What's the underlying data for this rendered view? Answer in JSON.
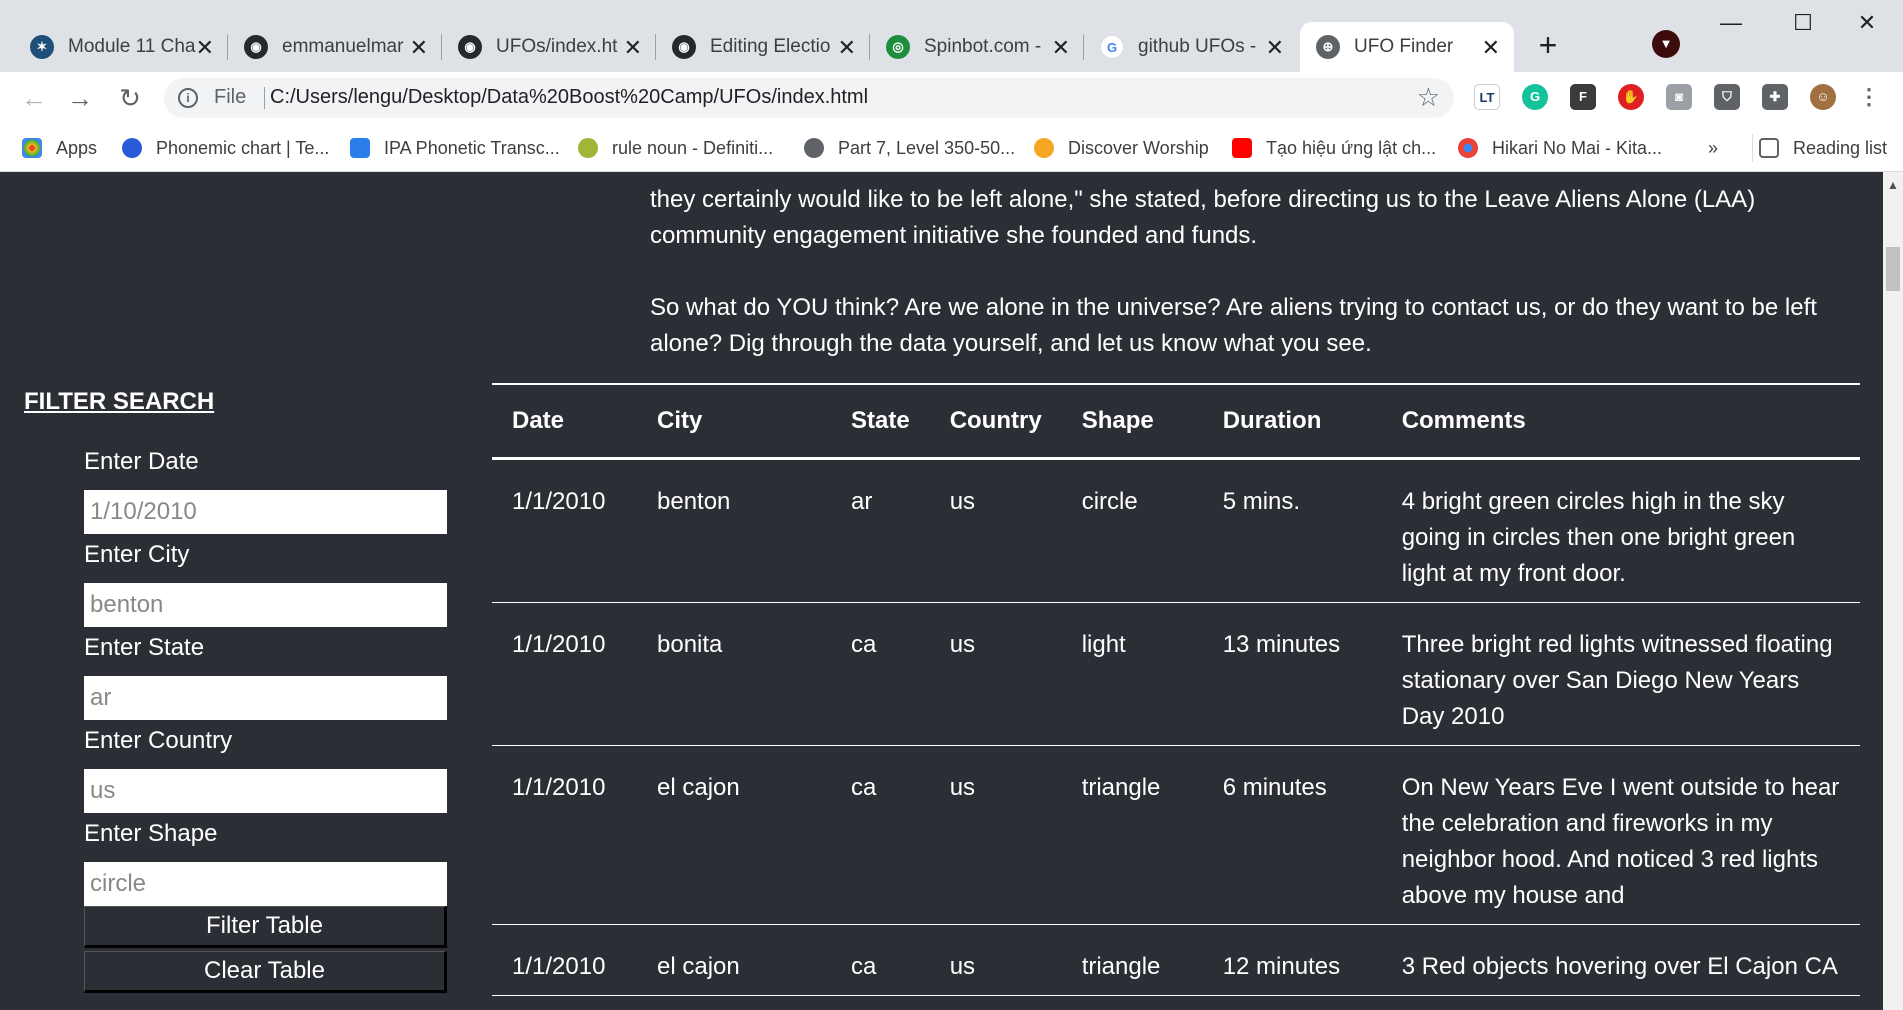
{
  "browser": {
    "tabs": [
      {
        "title": "Module 11 Cha",
        "icon": "hub-icon"
      },
      {
        "title": "emmanuelmar",
        "icon": "github-icon"
      },
      {
        "title": "UFOs/index.ht",
        "icon": "github-icon"
      },
      {
        "title": "Editing Electio",
        "icon": "github-icon"
      },
      {
        "title": "Spinbot.com -",
        "icon": "spinbot-icon"
      },
      {
        "title": "github UFOs -",
        "icon": "google-icon"
      },
      {
        "title": "UFO Finder",
        "icon": "globe-icon"
      }
    ],
    "address": {
      "scheme_label": "File",
      "url": "C:/Users/lengu/Desktop/Data%20Boost%20Camp/UFOs/index.html"
    },
    "bookmarks": [
      {
        "label": "Apps"
      },
      {
        "label": "Phonemic chart | Te..."
      },
      {
        "label": "IPA Phonetic Transc..."
      },
      {
        "label": "rule noun - Definiti..."
      },
      {
        "label": "Part 7, Level 350-50..."
      },
      {
        "label": "Discover Worship"
      },
      {
        "label": "Tạo hiệu ứng lật ch..."
      },
      {
        "label": "Hikari No Mai - Kita..."
      }
    ],
    "overflow_label": "»",
    "reading_list_label": "Reading list"
  },
  "article": {
    "p1_line1": "they certainly would like to be left alone,\" she stated, before directing us to the Leave Aliens Alone (LAA)",
    "p1_line2": "community engagement initiative she founded and funds.",
    "p2_line1": "So what do YOU think? Are we alone in the universe? Are aliens trying to contact us, or do they want to be left",
    "p2_line2": "alone? Dig through the data yourself, and let us know what you see."
  },
  "filter": {
    "title": "FILTER SEARCH",
    "date_label": "Enter Date",
    "date_placeholder": "1/10/2010",
    "city_label": "Enter City",
    "city_placeholder": "benton",
    "state_label": "Enter State",
    "state_placeholder": "ar",
    "country_label": "Enter Country",
    "country_placeholder": "us",
    "shape_label": "Enter Shape",
    "shape_placeholder": "circle",
    "filter_button": "Filter Table",
    "clear_button": "Clear Table"
  },
  "table": {
    "headers": [
      "Date",
      "City",
      "State",
      "Country",
      "Shape",
      "Duration",
      "Comments"
    ],
    "rows": [
      [
        "1/1/2010",
        "benton",
        "ar",
        "us",
        "circle",
        "5 mins.",
        "4 bright green circles high in the sky going in circles then one bright green light at my front door."
      ],
      [
        "1/1/2010",
        "bonita",
        "ca",
        "us",
        "light",
        "13 minutes",
        "Three bright red lights witnessed floating stationary over San Diego New Years Day 2010"
      ],
      [
        "1/1/2010",
        "el cajon",
        "ca",
        "us",
        "triangle",
        "6 minutes",
        "On New Years Eve I went outside to hear the celebration and fireworks in my neighbor hood. And noticed 3 red lights above my house and"
      ],
      [
        "1/1/2010",
        "el cajon",
        "ca",
        "us",
        "triangle",
        "12 minutes",
        "3 Red objects hovering over El Cajon CA"
      ]
    ]
  }
}
